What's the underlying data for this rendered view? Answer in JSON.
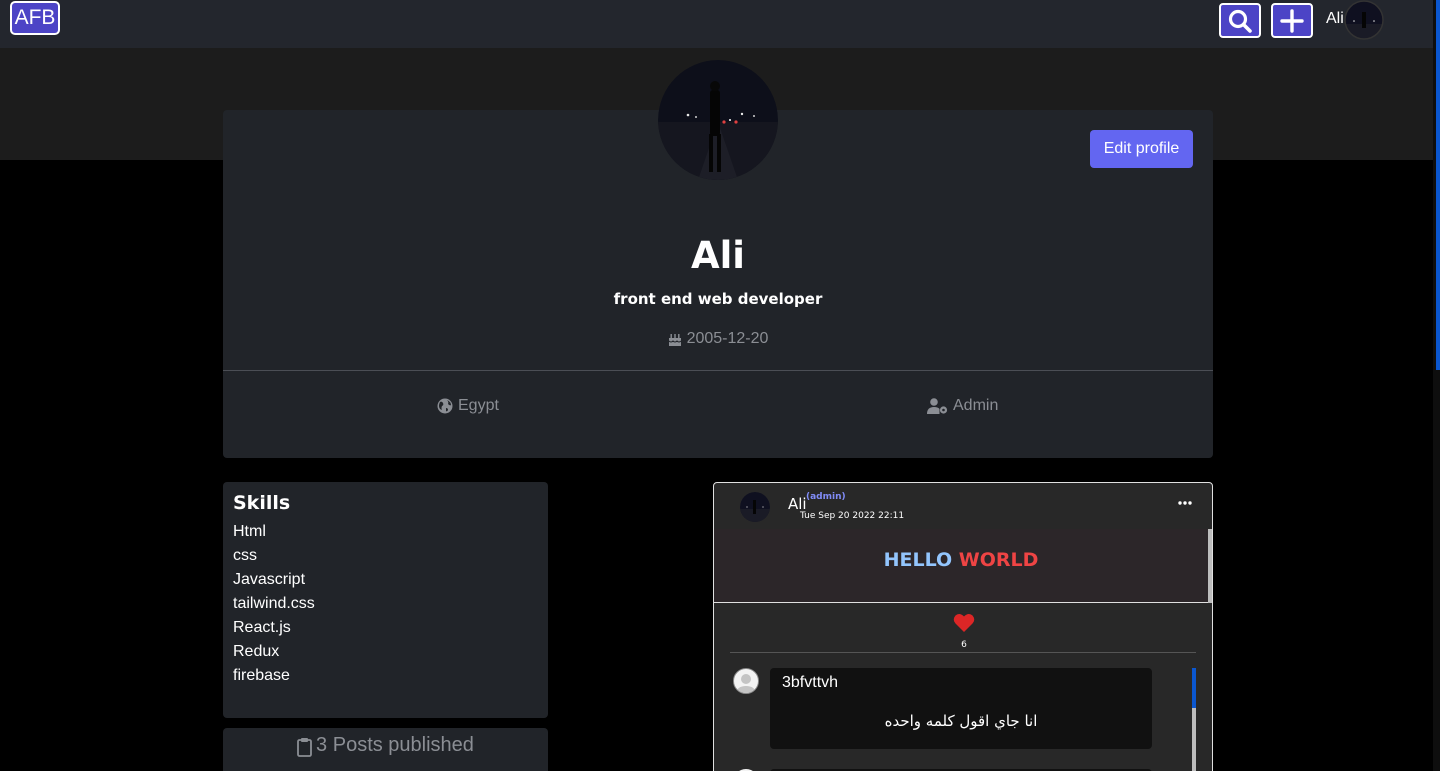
{
  "nav": {
    "logo": "AFB",
    "user_name": "Ali",
    "search_icon": "search-icon",
    "add_icon": "plus-icon"
  },
  "profile": {
    "name": "Ali",
    "title": "front end web developer",
    "birthday": "2005-12-20",
    "country": "Egypt",
    "role": "Admin",
    "edit_label": "Edit profile"
  },
  "skills": {
    "heading": "Skills",
    "items": [
      "Html",
      "css",
      "Javascript",
      "tailwind.css",
      "React.js",
      "Redux",
      "firebase"
    ]
  },
  "posts_summary": {
    "label": "3 Posts published"
  },
  "post": {
    "author": "Ali",
    "badge": "(admin)",
    "date": "Tue Sep 20 2022 22:11",
    "text_word1": "HELLO",
    "text_word2": "WORLD",
    "likes": "6",
    "comments": [
      {
        "user": "3bfvttvh",
        "text": "انا جاي اقول كلمه واحده"
      }
    ]
  },
  "colors": {
    "accent": "#6366f1",
    "nav_button": "#4c44c6",
    "card": "#212429",
    "heart": "#dc2626"
  }
}
